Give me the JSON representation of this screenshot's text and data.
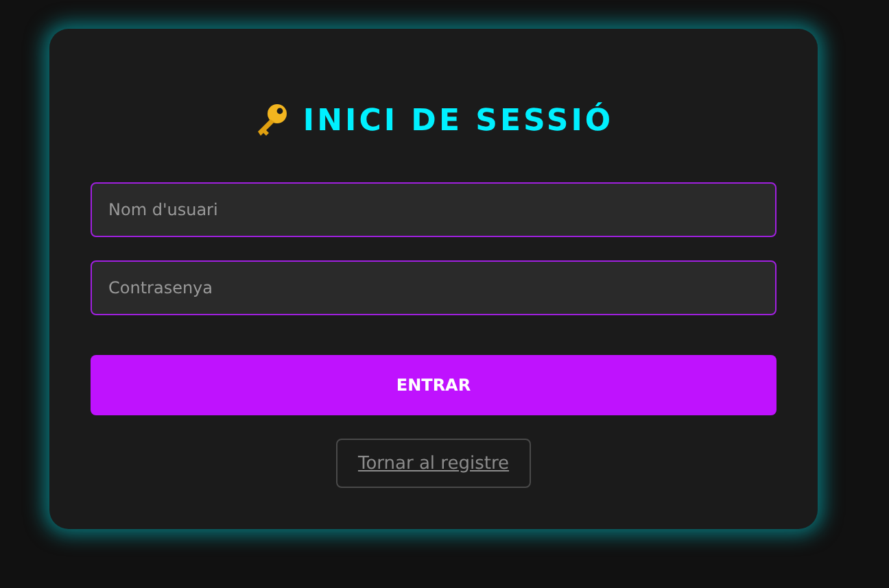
{
  "title": "INICI DE SESSIÓ",
  "fields": [
    {
      "placeholder": "Nom d'usuari"
    },
    {
      "placeholder": "Contrasenya"
    }
  ],
  "submit": "ENTRAR",
  "back_link": "Tornar al registre"
}
